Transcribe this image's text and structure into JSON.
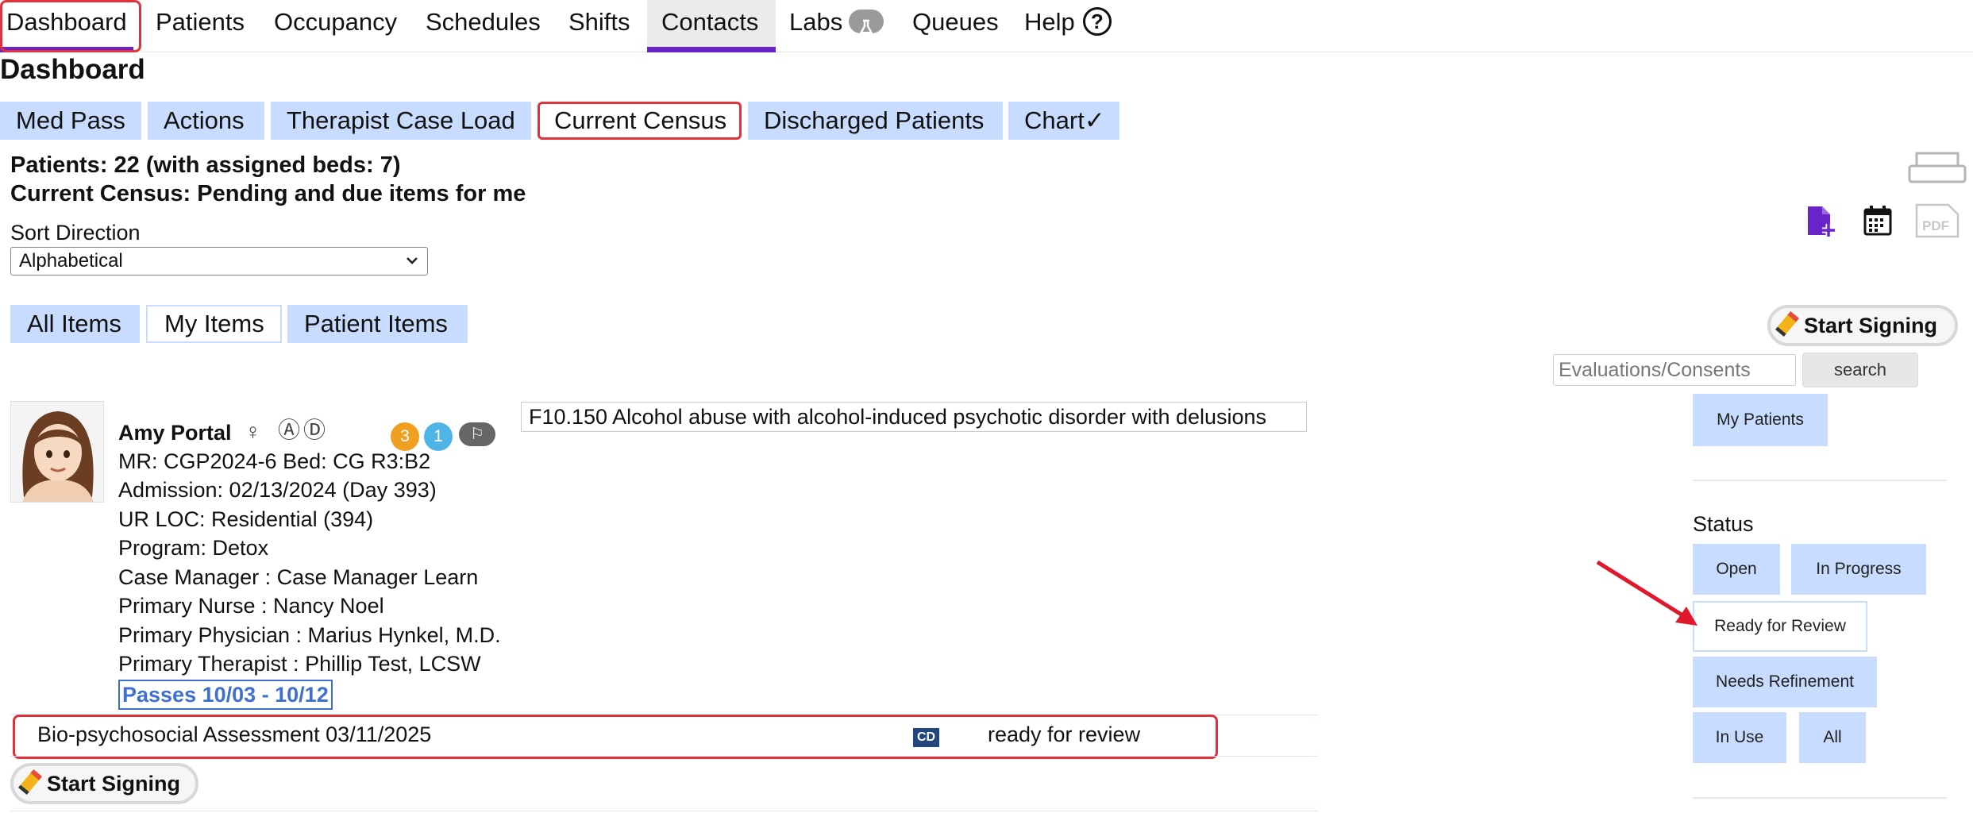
{
  "nav": {
    "tabs": [
      {
        "label": "Dashboard"
      },
      {
        "label": "Patients"
      },
      {
        "label": "Occupancy"
      },
      {
        "label": "Schedules"
      },
      {
        "label": "Shifts"
      },
      {
        "label": "Contacts"
      },
      {
        "label": "Labs"
      },
      {
        "label": "Queues"
      },
      {
        "label": "Help"
      }
    ],
    "labs_icon": "flask-icon",
    "help_icon": "question-circle-icon",
    "help_symbol": "?"
  },
  "page_title": "Dashboard",
  "subtabs": [
    "Med Pass",
    "Actions",
    "Therapist Case Load",
    "Current Census",
    "Discharged Patients",
    "Chart✓"
  ],
  "summary": {
    "patients_line": "Patients: 22 (with assigned beds: 7)",
    "census_line": "Current Census: Pending and due items for me"
  },
  "sort": {
    "label": "Sort Direction",
    "selected": "Alphabetical"
  },
  "item_tabs": [
    "All Items",
    "My Items",
    "Patient Items"
  ],
  "toolbar_icons": [
    "printer-icon",
    "add-document-icon",
    "calendar-icon",
    "pdf-icon"
  ],
  "pdf_text": "PDF",
  "start_signing_label": "Start Signing",
  "search": {
    "placeholder": "Evaluations/Consents",
    "button": "search"
  },
  "my_patients_label": "My Patients",
  "status": {
    "label": "Status",
    "buttons": [
      "Open",
      "In Progress",
      "Ready for Review",
      "Needs Refinement",
      "In Use",
      "All"
    ],
    "selected": "Ready for Review"
  },
  "patient": {
    "name": "Amy Portal",
    "gender_symbol": "♀",
    "marker_a": "Ⓐ",
    "marker_d": "Ⓓ",
    "badges": [
      {
        "value": "3",
        "color": "#f0a020"
      },
      {
        "value": "1",
        "color": "#4fb4e6"
      }
    ],
    "flag_symbol": "⚐",
    "mr_line": "MR: CGP2024-6    Bed: CG R3:B2",
    "admission": "Admission: 02/13/2024 (Day 393)",
    "ur_loc": "UR LOC: Residential (394)",
    "program": "Program: Detox",
    "case_manager": "Case Manager  :  Case Manager Learn",
    "primary_nurse": "Primary Nurse  :  Nancy Noel",
    "primary_physician": "Primary Physician  :  Marius Hynkel, M.D.",
    "primary_therapist": "Primary Therapist  :  Phillip Test, LCSW",
    "passes": "Passes 10/03 - 10/12",
    "diagnosis": "F10.150 Alcohol abuse with alcohol-induced psychotic disorder with delusions"
  },
  "assessment": {
    "label": "Bio-psychosocial Assessment 03/11/2025",
    "badge": "CD",
    "status": "ready for review"
  },
  "colors": {
    "accent_purple": "#6a22c9",
    "tab_blue": "#c7dcff",
    "highlight_red": "#e0323a",
    "link_blue": "#3f6fd1"
  }
}
